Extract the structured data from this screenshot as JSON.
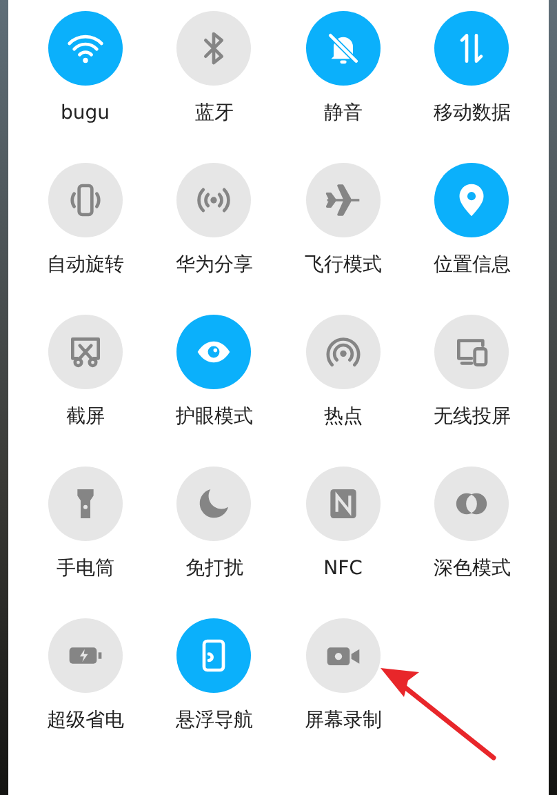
{
  "tiles": [
    {
      "label": "bugu",
      "on": true
    },
    {
      "label": "蓝牙",
      "on": false
    },
    {
      "label": "静音",
      "on": true
    },
    {
      "label": "移动数据",
      "on": true
    },
    {
      "label": "自动旋转",
      "on": false
    },
    {
      "label": "华为分享",
      "on": false
    },
    {
      "label": "飞行模式",
      "on": false
    },
    {
      "label": "位置信息",
      "on": true
    },
    {
      "label": "截屏",
      "on": false
    },
    {
      "label": "护眼模式",
      "on": true
    },
    {
      "label": "热点",
      "on": false
    },
    {
      "label": "无线投屏",
      "on": false
    },
    {
      "label": "手电筒",
      "on": false
    },
    {
      "label": "免打扰",
      "on": false
    },
    {
      "label": "NFC",
      "on": false
    },
    {
      "label": "深色模式",
      "on": false
    },
    {
      "label": "超级省电",
      "on": false
    },
    {
      "label": "悬浮导航",
      "on": true
    },
    {
      "label": "屏幕录制",
      "on": false
    }
  ],
  "annotations": [
    {
      "kind": "arrow"
    }
  ]
}
